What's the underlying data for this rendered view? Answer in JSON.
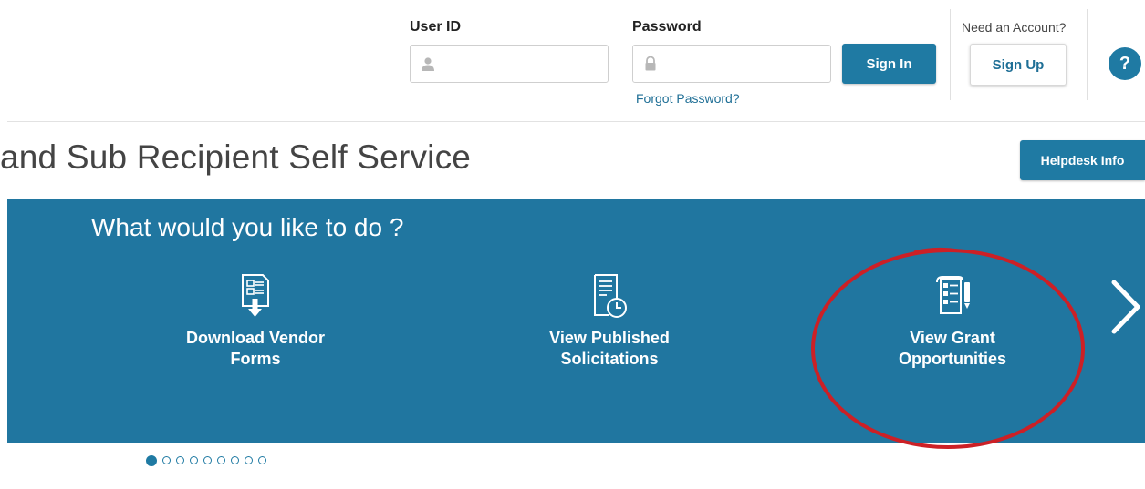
{
  "login": {
    "user_label": "User ID",
    "user_value": "",
    "password_label": "Password",
    "password_value": "",
    "signin_label": "Sign In",
    "forgot_label": "Forgot Password?"
  },
  "account": {
    "prompt": "Need an Account?",
    "signup_label": "Sign Up"
  },
  "help": {
    "symbol": "?"
  },
  "page": {
    "title": "and Sub Recipient Self Service",
    "helpdesk_label": "Helpdesk Info"
  },
  "banner": {
    "question": "What would you like to do ?",
    "tiles": [
      {
        "line1": "Download Vendor",
        "line2": "Forms",
        "icon": "download-form-icon"
      },
      {
        "line1": "View Published",
        "line2": "Solicitations",
        "icon": "solicitation-clock-icon"
      },
      {
        "line1": "View Grant",
        "line2": "Opportunities",
        "icon": "grant-scroll-icon"
      }
    ],
    "next_icon": "chevron-right-icon",
    "highlighted_tile": "View Grant Opportunities"
  },
  "pager": {
    "count": 9,
    "active": 1
  },
  "colors": {
    "primary": "#1f7aa3",
    "banner": "#2076a0",
    "highlight": "#cc2026"
  }
}
